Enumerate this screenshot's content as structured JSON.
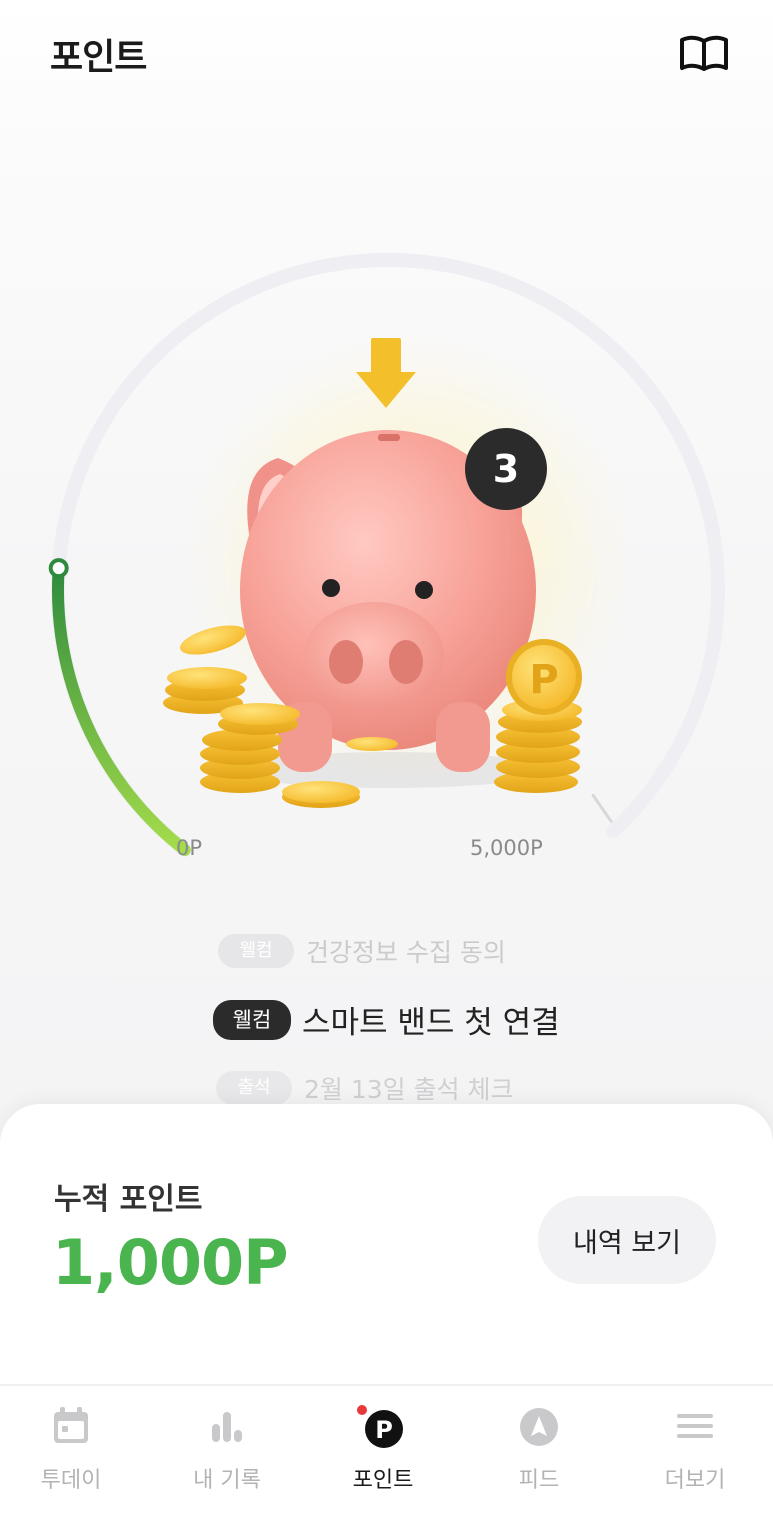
{
  "header": {
    "title": "포인트",
    "guide_icon": "open-book-icon"
  },
  "gauge": {
    "min_label": "0P",
    "max_label": "5,000P",
    "progress": 0.2,
    "badge_count": "3",
    "illustration": "piggy-bank-with-coins",
    "colors": {
      "progress_start": "#2e8b3e",
      "progress_end": "#a5dc4b",
      "track": "#efeff3"
    }
  },
  "missions": [
    {
      "tag": "웰컴",
      "text": "건강정보 수집 동의",
      "state": "done"
    },
    {
      "tag": "웰컴",
      "text": "스마트 밴드 첫 연결",
      "state": "current"
    },
    {
      "tag": "출석",
      "text": "2월 13일 출석 체크",
      "state": "upcoming"
    }
  ],
  "summary": {
    "label": "누적 포인트",
    "value": "1,000P",
    "history_button": "내역 보기",
    "accent": "#4ab54f"
  },
  "nav": {
    "items": [
      {
        "label": "투데이",
        "icon": "calendar-icon",
        "active": false
      },
      {
        "label": "내 기록",
        "icon": "bar-chart-icon",
        "active": false
      },
      {
        "label": "포인트",
        "icon": "point-p-icon",
        "active": true
      },
      {
        "label": "피드",
        "icon": "compass-arrow-icon",
        "active": false
      },
      {
        "label": "더보기",
        "icon": "menu-icon",
        "active": false
      }
    ]
  }
}
